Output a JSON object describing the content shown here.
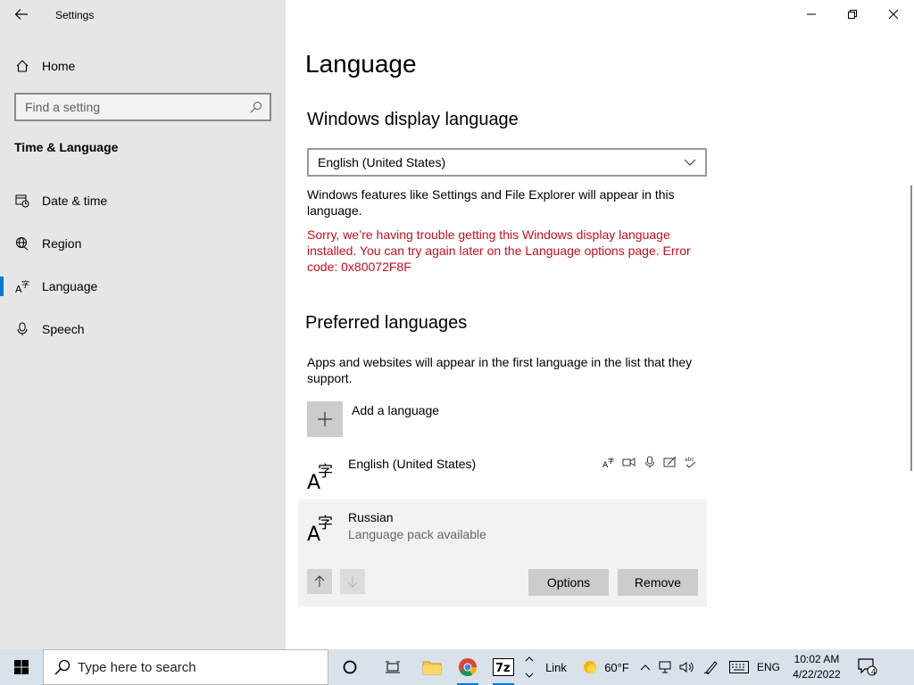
{
  "window": {
    "title": "Settings"
  },
  "sidebar": {
    "home": "Home",
    "search_placeholder": "Find a setting",
    "section": "Time & Language",
    "items": [
      {
        "label": "Date & time",
        "icon": "calendar-clock-icon"
      },
      {
        "label": "Region",
        "icon": "globe-icon"
      },
      {
        "label": "Language",
        "icon": "language-icon",
        "active": true
      },
      {
        "label": "Speech",
        "icon": "microphone-icon"
      }
    ]
  },
  "main": {
    "title": "Language",
    "display_language": {
      "heading": "Windows display language",
      "selected": "English (United States)",
      "description": "Windows features like Settings and File Explorer will appear in this language.",
      "error": "Sorry, we’re having trouble getting this Windows display language installed. You can try again later on the Language options page. Error code: 0x80072F8F"
    },
    "preferred": {
      "heading": "Preferred languages",
      "description": "Apps and websites will appear in the first language in the list that they support.",
      "add_label": "Add a language",
      "languages": [
        {
          "name": "English (United States)",
          "status": ""
        },
        {
          "name": "Russian",
          "status": "Language pack available"
        }
      ],
      "options_label": "Options",
      "remove_label": "Remove"
    }
  },
  "taskbar": {
    "search_placeholder": "Type here to search",
    "link_label": "Link",
    "weather": "60°F",
    "lang": "ENG",
    "time": "10:02 AM",
    "date": "4/22/2022",
    "notifications": "4"
  },
  "colors": {
    "accent": "#0078d4",
    "error": "#c50f1f",
    "sidebar_bg": "#e6e6e6"
  }
}
